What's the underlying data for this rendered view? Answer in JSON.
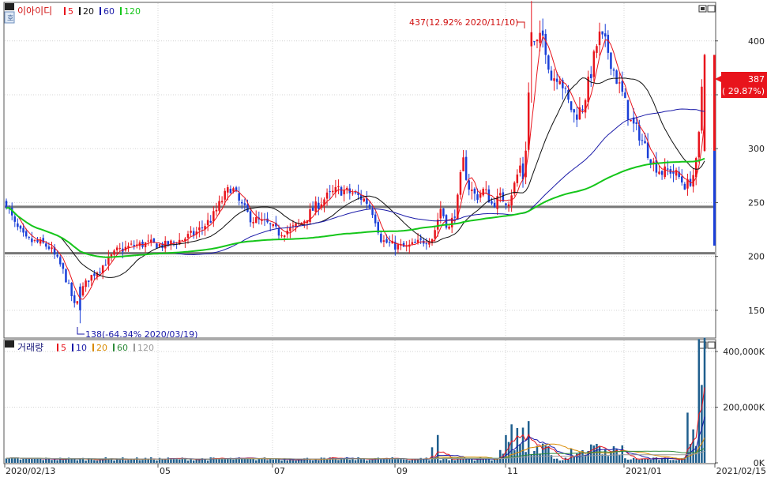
{
  "price_panel": {
    "name": "이아이디",
    "ma_legend": [
      {
        "label": "5",
        "color": "#e8141c"
      },
      {
        "label": "20",
        "color": "#111111"
      },
      {
        "label": "60",
        "color": "#1a1aa8"
      },
      {
        "label": "120",
        "color": "#15c61a"
      }
    ],
    "y_ticks": [
      "400",
      "350",
      "300",
      "250",
      "200",
      "150"
    ],
    "current_price_badge": {
      "price": "387",
      "change": "( 29.87%)",
      "color": "#e8141c"
    },
    "high_annotation": "437(12.92% 2020/11/10)",
    "low_annotation": "138(-64.34% 2020/03/19)"
  },
  "volume_panel": {
    "name": "거래량",
    "ma_legend": [
      {
        "label": "5",
        "color": "#e8141c"
      },
      {
        "label": "10",
        "color": "#1a1aa8"
      },
      {
        "label": "20",
        "color": "#d98a00"
      },
      {
        "label": "60",
        "color": "#2e8b3a"
      },
      {
        "label": "120",
        "color": "#9a9a9a"
      }
    ],
    "y_ticks": [
      "400,000K",
      "200,000K",
      "0K"
    ]
  },
  "x_ticks": [
    "2020/02/13",
    "05",
    "07",
    "09",
    "11",
    "2021/01",
    "2021/02/15"
  ],
  "chart_data": {
    "type": "candlestick",
    "x_range": [
      "2020/02/13",
      "2021/02/15"
    ],
    "price_ylim": [
      125,
      435
    ],
    "volume_ylim_k": [
      0,
      440000
    ],
    "price_key_points": [
      {
        "date": "2020/02/13",
        "close": 250
      },
      {
        "date": "2020/03/19",
        "low": 138
      },
      {
        "date": "2020/04",
        "close": 200
      },
      {
        "date": "2020/06",
        "close": 250
      },
      {
        "date": "2020/08",
        "close": 255
      },
      {
        "date": "2020/09",
        "close": 210
      },
      {
        "date": "2020/10",
        "close": 260
      },
      {
        "date": "2020/11/10",
        "high": 437
      },
      {
        "date": "2020/12",
        "close": 360
      },
      {
        "date": "2021/01",
        "close": 285
      },
      {
        "date": "2021/02/15",
        "close": 387
      }
    ],
    "support_lines": [
      246,
      203
    ],
    "last_price": 387,
    "last_change_pct": 29.87
  }
}
